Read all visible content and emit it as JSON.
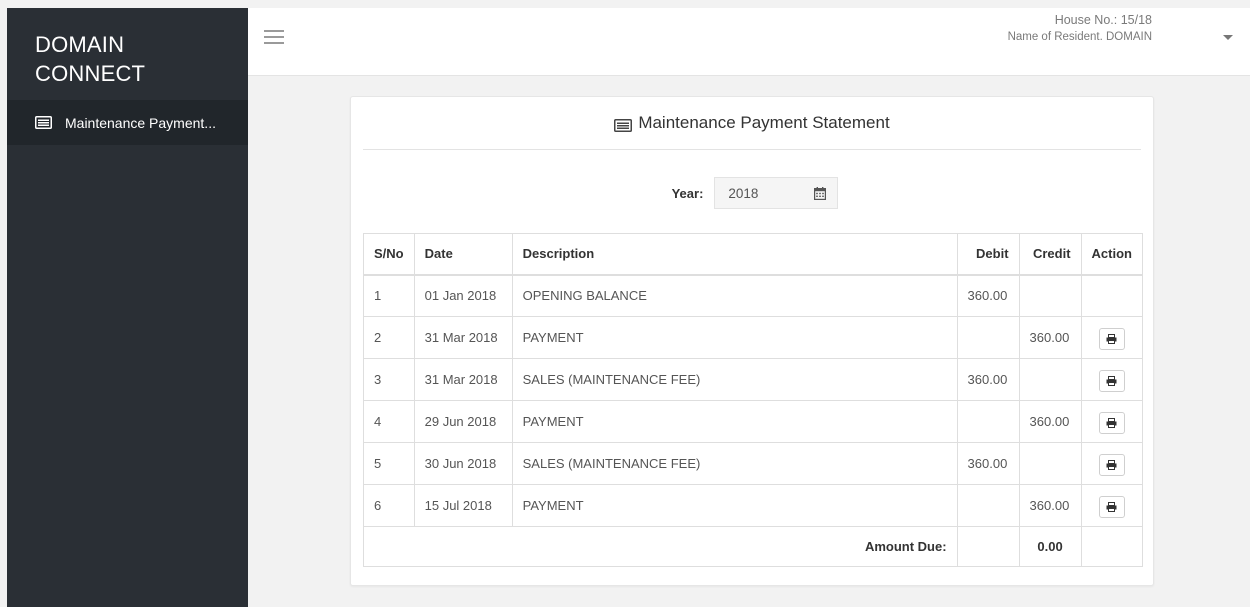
{
  "sidebar": {
    "brand_line1": "DOMAIN",
    "brand_line2": "CONNECT",
    "items": [
      {
        "label": "Maintenance Payment...",
        "icon": "list-icon"
      }
    ]
  },
  "header": {
    "house_label": "House No.: 15/18",
    "resident_label": "Name of Resident. ",
    "resident_name": "DOMAIN"
  },
  "statement": {
    "title": "Maintenance Payment Statement",
    "year_label": "Year:",
    "year_value": "2018",
    "columns": [
      "S/No",
      "Date",
      "Description",
      "Debit",
      "Credit",
      "Action"
    ],
    "rows": [
      {
        "sno": "1",
        "date": "01 Jan 2018",
        "description": "OPENING BALANCE",
        "debit": "360.00",
        "credit": ""
      },
      {
        "sno": "2",
        "date": "31 Mar 2018",
        "description": "PAYMENT",
        "debit": "",
        "credit": "360.00"
      },
      {
        "sno": "3",
        "date": "31 Mar 2018",
        "description": "SALES (MAINTENANCE FEE)",
        "debit": "360.00",
        "credit": ""
      },
      {
        "sno": "4",
        "date": "29 Jun 2018",
        "description": "PAYMENT",
        "debit": "",
        "credit": "360.00"
      },
      {
        "sno": "5",
        "date": "30 Jun 2018",
        "description": "SALES (MAINTENANCE FEE)",
        "debit": "360.00",
        "credit": ""
      },
      {
        "sno": "6",
        "date": "15 Jul 2018",
        "description": "PAYMENT",
        "debit": "",
        "credit": "360.00"
      }
    ],
    "total_label": "Amount Due:",
    "total_value": "0.00"
  },
  "colors": {
    "sidebar_bg": "#2a2f35",
    "sidebar_active_bg": "#21262b",
    "page_bg": "#f2f2f2"
  }
}
